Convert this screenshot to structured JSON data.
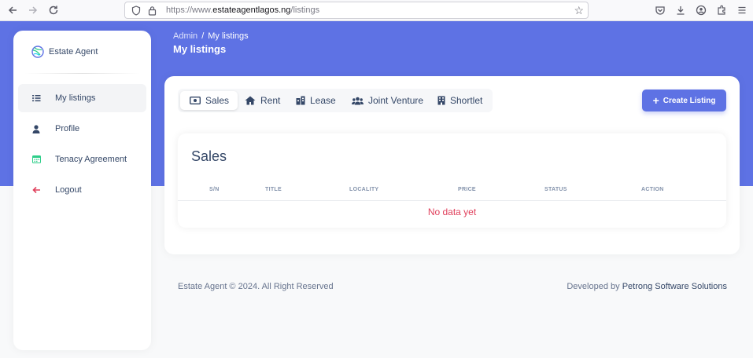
{
  "browser": {
    "url_prefix": "https://www.",
    "url_domain": "estateagentlagos.ng",
    "url_path": "/listings"
  },
  "brand": {
    "name": "Estate Agent"
  },
  "breadcrumb": {
    "parent": "Admin",
    "separator": "/",
    "current": "My listings"
  },
  "page_title": "My listings",
  "sidebar": {
    "items": [
      {
        "label": "My listings",
        "icon": "list-icon",
        "active": true
      },
      {
        "label": "Profile",
        "icon": "user-icon",
        "active": false
      },
      {
        "label": "Tenacy Agreement",
        "icon": "calendar-icon",
        "active": false
      },
      {
        "label": "Logout",
        "icon": "arrow-left-icon",
        "active": false
      }
    ]
  },
  "tabs": [
    {
      "label": "Sales",
      "icon": "money-bill-icon",
      "active": true
    },
    {
      "label": "Rent",
      "icon": "home-icon",
      "active": false
    },
    {
      "label": "Lease",
      "icon": "building-icon",
      "active": false
    },
    {
      "label": "Joint Venture",
      "icon": "users-icon",
      "active": false
    },
    {
      "label": "Shortlet",
      "icon": "hotel-icon",
      "active": false
    }
  ],
  "create_button": {
    "icon": "plus-icon",
    "label": "Create Listing"
  },
  "table": {
    "title": "Sales",
    "headers": [
      "S/N",
      "TITLE",
      "LOCALITY",
      "PRICE",
      "STATUS",
      "ACTION"
    ],
    "empty_message": "No data yet"
  },
  "footer": {
    "copyright": "Estate Agent © 2024. All Right Reserved",
    "developed_by": "Developed by",
    "company": "Petrong Software Solutions"
  },
  "colors": {
    "primary": "#5e72e4",
    "text_dark": "#344767",
    "danger": "#e0405c",
    "success": "#2dce89"
  }
}
